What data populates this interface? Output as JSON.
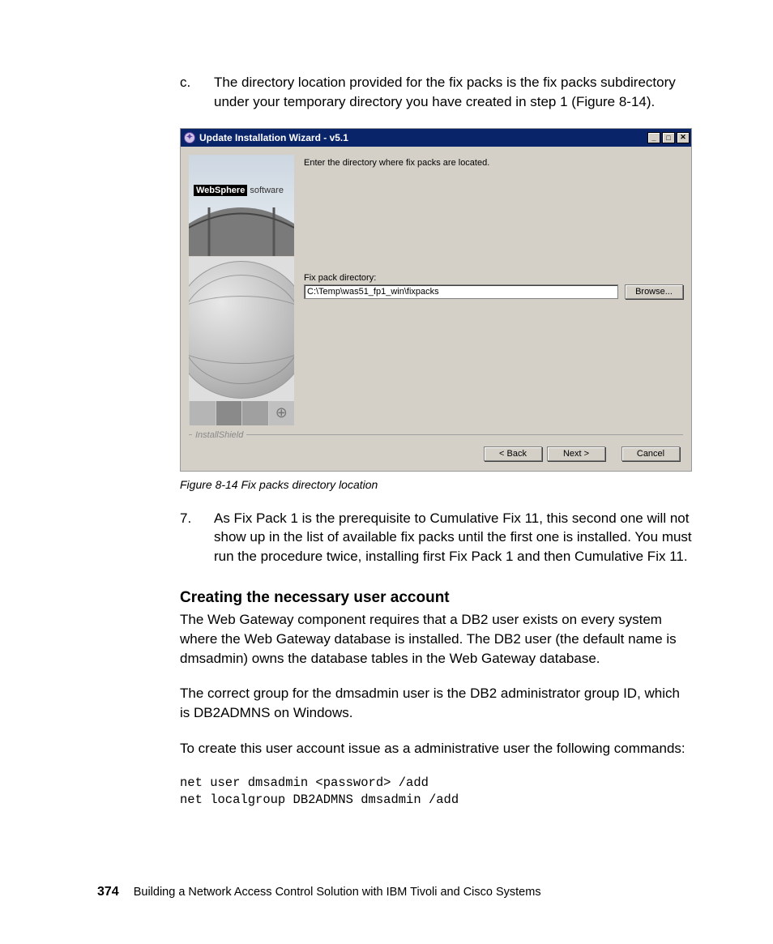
{
  "list_c": {
    "marker": "c.",
    "text": "The directory location provided for the fix packs is the fix packs subdirectory under your temporary directory you have created in step 1 (Figure 8-14)."
  },
  "wizard": {
    "title": "Update Installation Wizard - v5.1",
    "banner_brand": "WebSphere",
    "banner_suffix": " software",
    "prompt": "Enter the directory where fix packs are located.",
    "field_label": "Fix pack directory:",
    "field_value": "C:\\Temp\\was51_fp1_win\\fixpacks",
    "browse": "Browse...",
    "legend": "InstallShield",
    "back": "< Back",
    "next": "Next >",
    "cancel": "Cancel"
  },
  "caption": "Figure 8-14   Fix packs directory location",
  "list_7": {
    "marker": "7.",
    "text": "As Fix Pack 1 is the prerequisite to Cumulative Fix 11, this second one will not show up in the list of available fix packs until the first one is installed. You must run the procedure twice, installing first Fix Pack 1 and then Cumulative Fix 11."
  },
  "heading": "Creating the necessary user account",
  "p1": "The Web Gateway component requires that a DB2 user exists on every system where the Web Gateway database is installed. The DB2 user (the default name is dmsadmin) owns the database tables in the Web Gateway database.",
  "p2": "The correct group for the dmsadmin user is the DB2 administrator group ID, which is DB2ADMNS on Windows.",
  "p3": "To create this user account issue as a administrative user the following commands:",
  "cmd": "net user dmsadmin <password> /add\nnet localgroup DB2ADMNS dmsadmin /add",
  "footer": {
    "page": "374",
    "title": "Building a Network Access Control Solution with IBM Tivoli and Cisco Systems"
  }
}
